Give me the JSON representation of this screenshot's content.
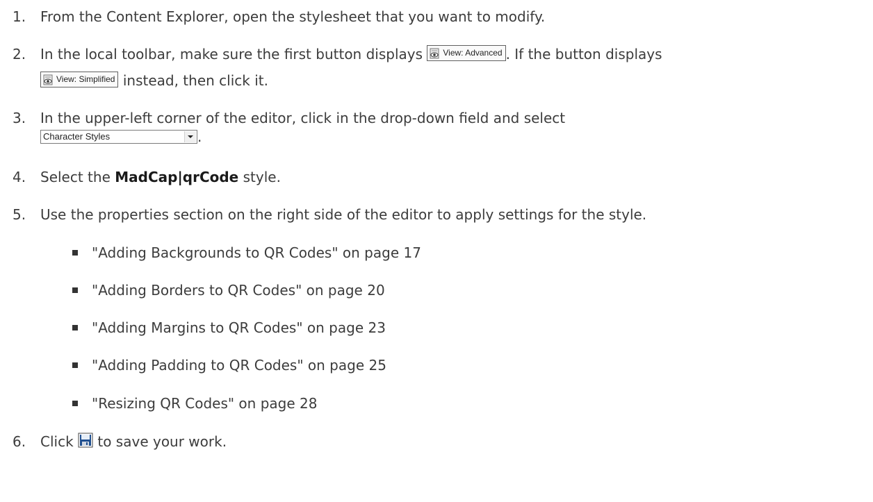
{
  "steps": [
    {
      "num": "1.",
      "text": "From the Content Explorer, open the stylesheet that you want to modify."
    },
    {
      "num": "2.",
      "pre": "In the local toolbar, make sure the first button displays",
      "btn_advanced": "View: Advanced",
      "mid": ". If the button displays",
      "btn_simplified": "View: Simplified",
      "post": " instead, then click it."
    },
    {
      "num": "3.",
      "text": "In the upper-left corner of the editor, click in the drop-down field and select",
      "dropdown_value": "Character Styles",
      "end": "."
    },
    {
      "num": "4.",
      "pre": "Select the ",
      "bold": "MadCap|qrCode",
      "post": " style."
    },
    {
      "num": "5.",
      "text": "Use the properties section on the right side of the editor to apply settings for the style."
    },
    {
      "num": "6.",
      "pre": "Click ",
      "post": " to save your work."
    }
  ],
  "links": [
    "\"Adding Backgrounds to QR Codes\" on page 17",
    "\"Adding Borders to QR Codes\" on page 20",
    "\"Adding Margins to QR Codes\" on page 23",
    "\"Adding Padding to QR Codes\" on page 25",
    "\"Resizing QR Codes\" on page 28"
  ],
  "icons": {
    "view_button": "view-eye-icon",
    "save_button": "floppy-disk-save-icon"
  },
  "colors": {
    "text": "#3c3c3c",
    "bullet": "#333333"
  }
}
